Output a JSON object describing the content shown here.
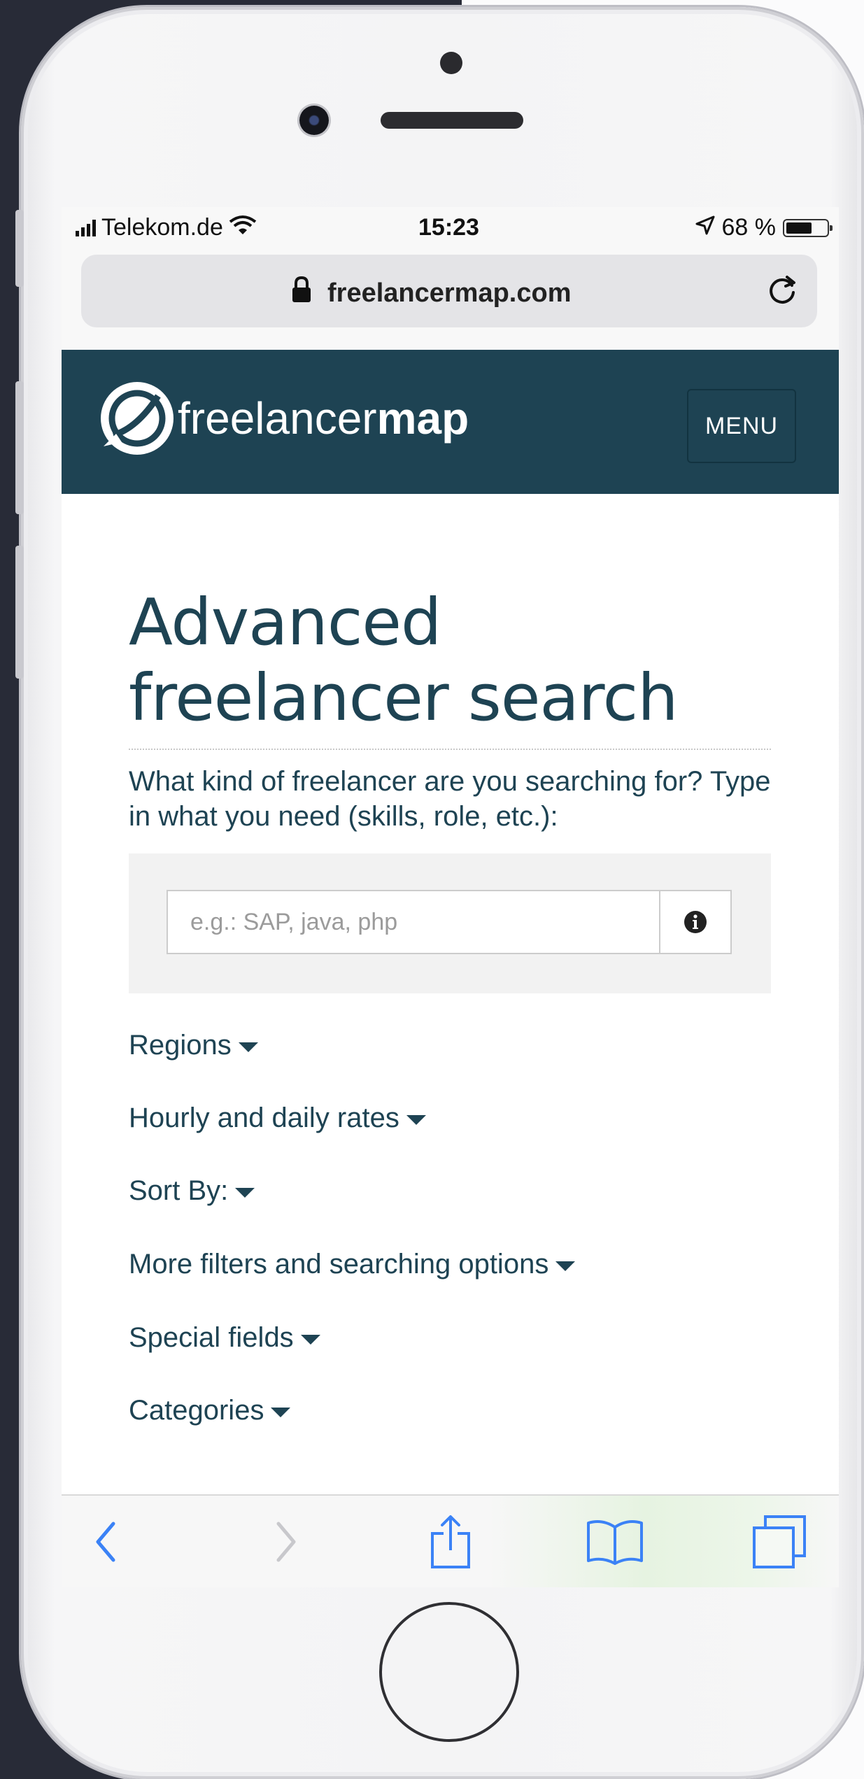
{
  "statusbar": {
    "carrier": "Telekom.de",
    "time": "15:23",
    "battery": "68 %",
    "battery_level": 0.68
  },
  "browser": {
    "url": "freelancermap.com"
  },
  "header": {
    "logo_prefix": "freelancer",
    "logo_suffix": "map",
    "menu_label": "MENU"
  },
  "main": {
    "title": "Advanced freelancer search",
    "prompt": "What kind of freelancer are you searching for? Type in what you need (skills, role, etc.):",
    "search_placeholder": "e.g.: SAP, java, php",
    "filters": [
      {
        "label": "Regions"
      },
      {
        "label": "Hourly and daily rates"
      },
      {
        "label": "Sort By:"
      },
      {
        "label": "More filters and searching options"
      },
      {
        "label": "Special fields"
      },
      {
        "label": "Categories"
      }
    ]
  },
  "icons": {
    "lock": "lock-icon",
    "reload": "reload-icon",
    "info": "info-icon",
    "back": "chevron-left-icon",
    "forward": "chevron-right-icon",
    "share": "share-icon",
    "bookmarks": "book-icon",
    "tabs": "tabs-icon"
  },
  "colors": {
    "brand": "#1e4353",
    "toolbar_accent": "#3b82f6",
    "background_dark": "#282b37"
  }
}
